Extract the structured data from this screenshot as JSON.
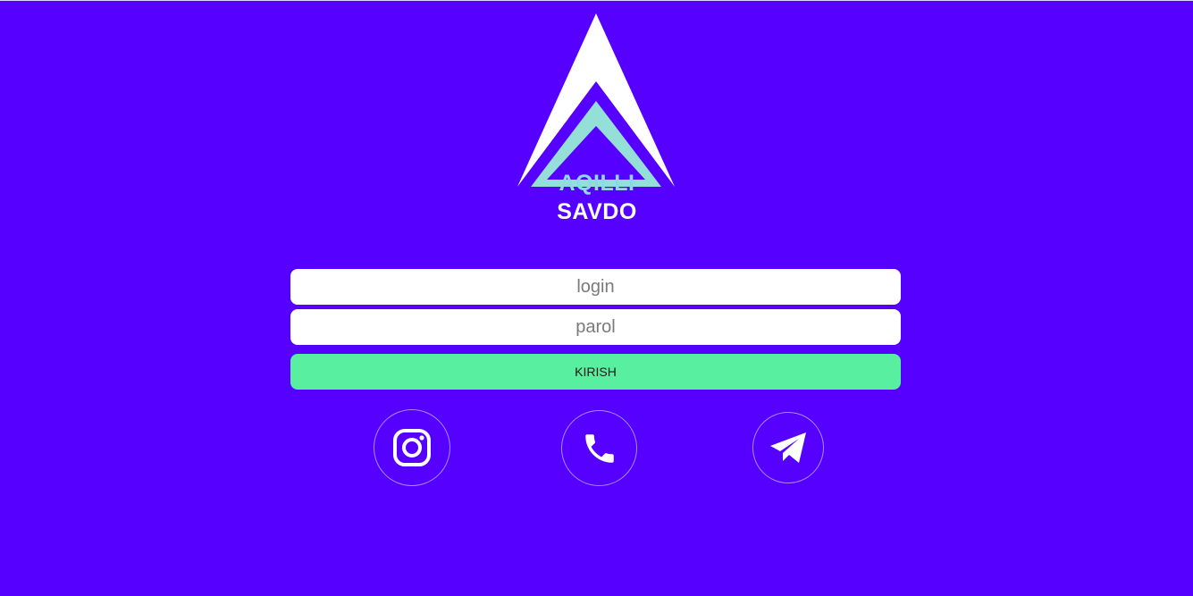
{
  "brand": {
    "line1": "AQILLI",
    "line2": "SAVDO",
    "colors": {
      "background": "#5600ff",
      "logo_white": "#ffffff",
      "logo_teal": "#94e0d8",
      "line1_text": "#8fd9e6",
      "accent_button": "#58f0a0"
    }
  },
  "form": {
    "login_placeholder": "login",
    "password_placeholder": "parol",
    "submit_label": "KIRISH"
  },
  "social": [
    {
      "name": "instagram",
      "icon": "instagram-icon"
    },
    {
      "name": "phone",
      "icon": "phone-icon"
    },
    {
      "name": "telegram",
      "icon": "telegram-icon"
    }
  ]
}
